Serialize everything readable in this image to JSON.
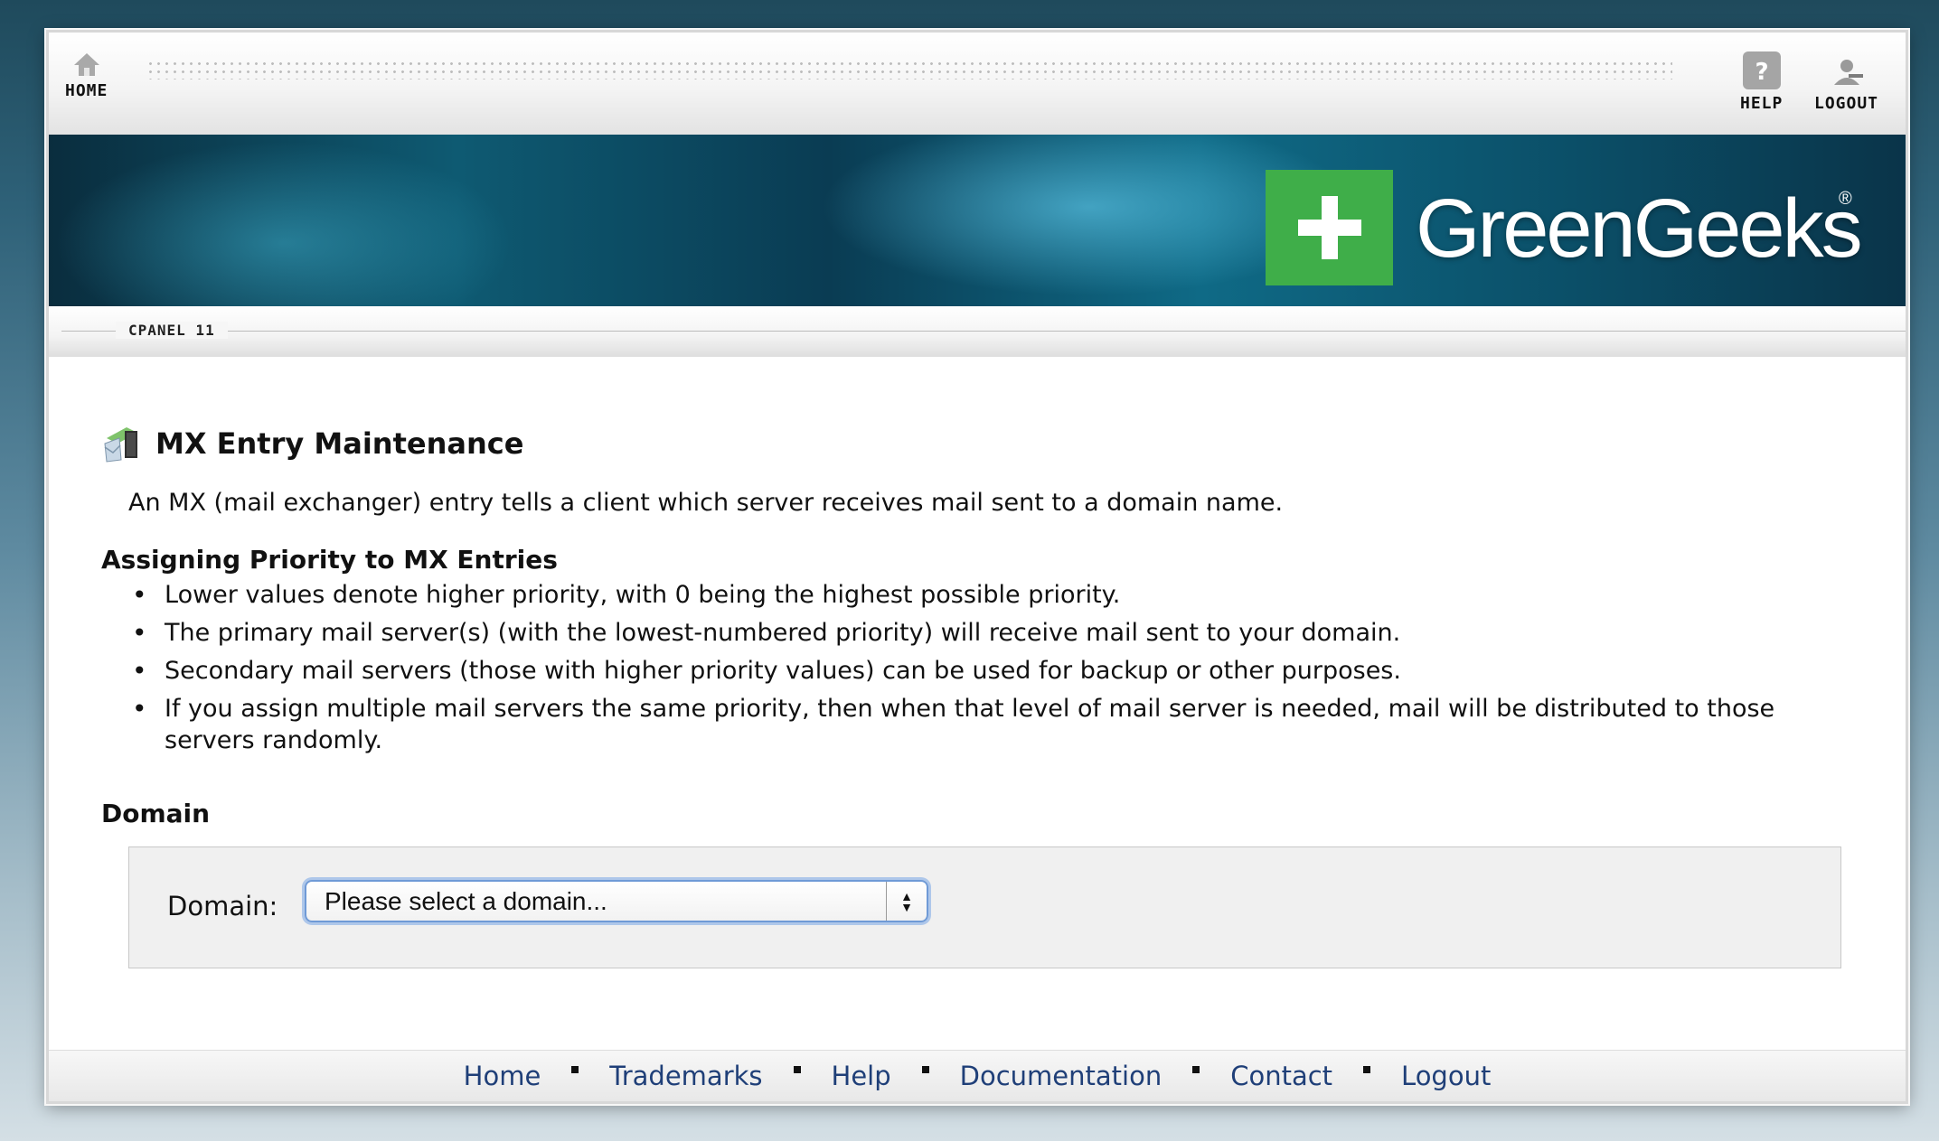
{
  "nav": {
    "home_label": "HOME",
    "help_label": "HELP",
    "logout_label": "LOGOUT"
  },
  "banner": {
    "brand": "GreenGeeks",
    "reg_mark": "®",
    "brand_color": "#3fae49"
  },
  "strip": {
    "label": "CPANEL 11"
  },
  "page": {
    "title": "MX Entry Maintenance",
    "intro": "An MX (mail exchanger) entry tells a client which server receives mail sent to a domain name.",
    "priority_heading": "Assigning Priority to MX Entries",
    "bullets": [
      "Lower values denote higher priority, with 0 being the highest possible priority.",
      "The primary mail server(s) (with the lowest-numbered priority) will receive mail sent to your domain.",
      "Secondary mail servers (those with higher priority values) can be used for backup or other purposes.",
      "If you assign multiple mail servers the same priority, then when that level of mail server is needed, mail will be distributed to those servers randomly."
    ],
    "domain_heading": "Domain",
    "domain_label": "Domain:",
    "domain_select_value": "Please select a domain..."
  },
  "footer": {
    "links": [
      "Home",
      "Trademarks",
      "Help",
      "Documentation",
      "Contact",
      "Logout"
    ]
  },
  "icons": {
    "home": "home-icon",
    "help": "help-icon",
    "logout": "logout-icon",
    "page": "mx-entry-icon",
    "logo": "greengeeks-plus-logo"
  }
}
